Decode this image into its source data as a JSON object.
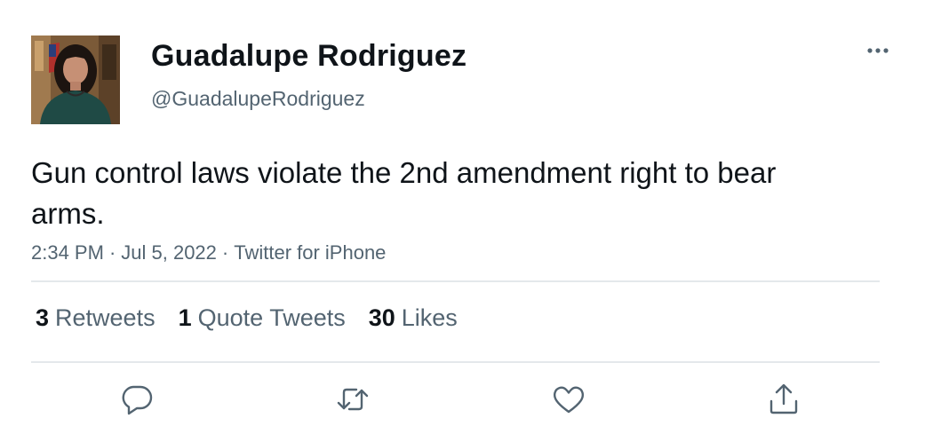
{
  "author": {
    "name": "Guadalupe Rodriguez",
    "handle": "@GuadalupeRodriguez"
  },
  "tweet": {
    "text": "Gun control laws violate the 2nd amendment right to bear arms.",
    "time": "2:34 PM",
    "date": "Jul 5, 2022",
    "source": "Twitter for iPhone",
    "separator": "·"
  },
  "stats": {
    "retweets_count": "3",
    "retweets_label": "Retweets",
    "quotes_count": "1",
    "quotes_label": "Quote Tweets",
    "likes_count": "30",
    "likes_label": "Likes"
  },
  "icons": {
    "more": "more-icon",
    "reply": "reply-icon",
    "retweet": "retweet-icon",
    "like": "like-icon",
    "share": "share-icon"
  },
  "colors": {
    "text": "#0f1419",
    "secondary": "#536471",
    "divider": "#e4e8eb",
    "background": "#ffffff"
  }
}
